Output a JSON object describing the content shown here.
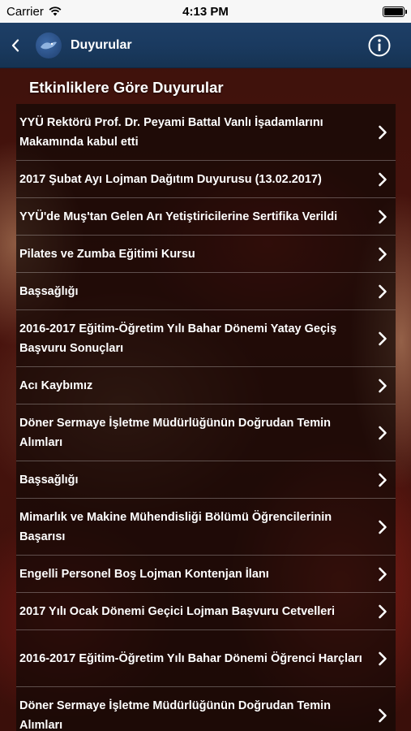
{
  "status_bar": {
    "carrier": "Carrier",
    "time": "4:13 PM"
  },
  "nav": {
    "title": "Duyurular",
    "back_icon": "chevron-left-icon",
    "info_icon": "info-circle-icon"
  },
  "section": {
    "heading": "Etkinliklere Göre Duyurular"
  },
  "announcements": [
    {
      "label": "YYÜ Rektörü Prof. Dr. Peyami Battal Vanlı İşadamlarını Makamında kabul etti"
    },
    {
      "label": "2017 Şubat Ayı Lojman Dağıtım Duyurusu (13.02.2017)"
    },
    {
      "label": "YYÜ'de Muş'tan Gelen Arı Yetiştiricilerine Sertifika Verildi"
    },
    {
      "label": "Pilates ve Zumba Eğitimi Kursu"
    },
    {
      "label": "Başsağlığı"
    },
    {
      "label": "2016-2017 Eğitim-Öğretim Yılı Bahar Dönemi Yatay Geçiş Başvuru Sonuçları"
    },
    {
      "label": "Acı Kaybımız"
    },
    {
      "label": "Döner Sermaye İşletme Müdürlüğünün Doğrudan Temin Alımları"
    },
    {
      "label": "Başsağlığı"
    },
    {
      "label": "Mimarlık ve Makine Mühendisliği Bölümü Öğrencilerinin Başarısı"
    },
    {
      "label": "Engelli Personel Boş Lojman Kontenjan İlanı"
    },
    {
      "label": "2017 Yılı Ocak Dönemi Geçici Lojman Başvuru Cetvelleri"
    },
    {
      "label": "2016-2017 Eğitim-Öğretim Yılı Bahar Dönemi Öğrenci Harçları"
    },
    {
      "label": "Döner Sermaye İşletme Müdürlüğünün Doğrudan Temin Alımları"
    }
  ],
  "colors": {
    "nav_bar": "#1a3a60",
    "status_bar": "#f7f7f7",
    "list_text": "#ffffff"
  }
}
